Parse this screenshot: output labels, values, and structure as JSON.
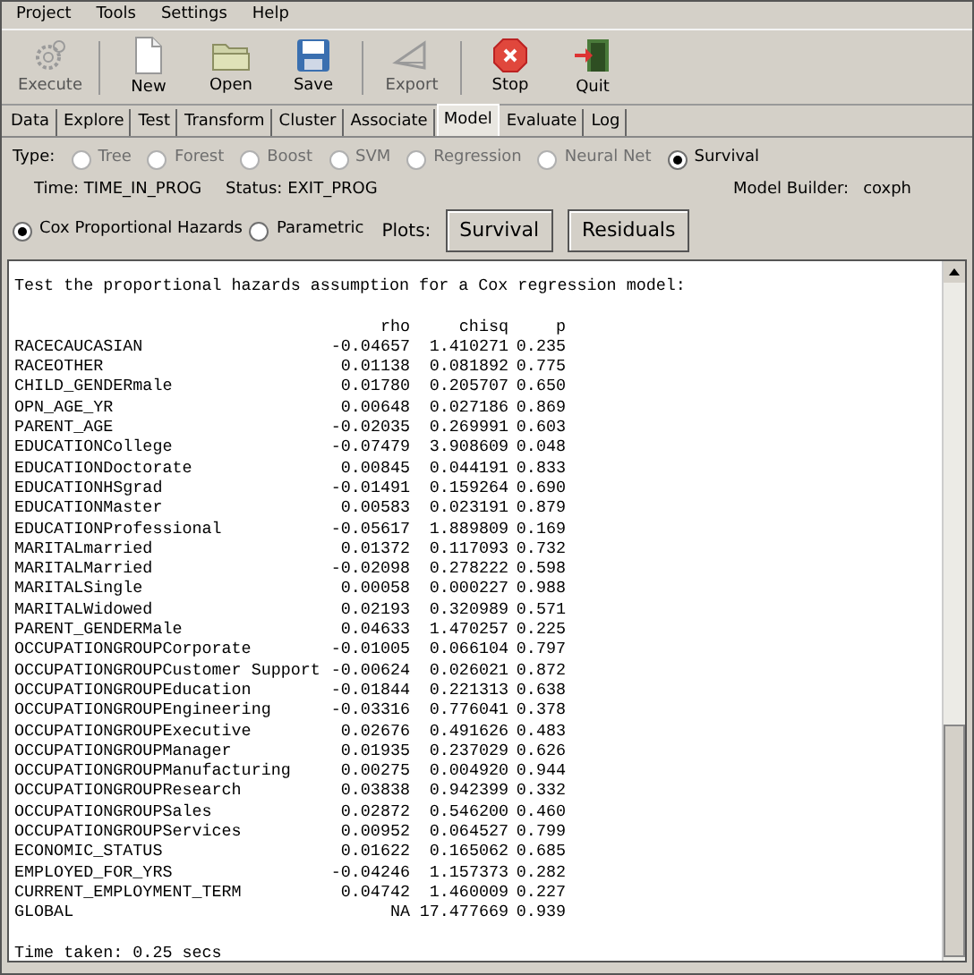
{
  "menu": [
    "Project",
    "Tools",
    "Settings",
    "Help"
  ],
  "toolbar": [
    {
      "label": "Execute",
      "kind": "gear",
      "disabled": true
    },
    {
      "label": "New",
      "kind": "new",
      "disabled": false
    },
    {
      "label": "Open",
      "kind": "open",
      "disabled": false
    },
    {
      "label": "Save",
      "kind": "save",
      "disabled": false
    },
    {
      "label": "Export",
      "kind": "export",
      "disabled": true
    },
    {
      "label": "Stop",
      "kind": "stop",
      "disabled": false
    },
    {
      "label": "Quit",
      "kind": "quit",
      "disabled": false
    }
  ],
  "tabs": [
    {
      "label": "Data",
      "selected": false
    },
    {
      "label": "Explore",
      "selected": false
    },
    {
      "label": "Test",
      "selected": false
    },
    {
      "label": "Transform",
      "selected": false
    },
    {
      "label": "Cluster",
      "selected": false
    },
    {
      "label": "Associate",
      "selected": false
    },
    {
      "label": "Model",
      "selected": true
    },
    {
      "label": "Evaluate",
      "selected": false
    },
    {
      "label": "Log",
      "selected": false
    }
  ],
  "type_label": "Type:",
  "types": [
    {
      "label": "Tree",
      "selected": false,
      "disabled": true
    },
    {
      "label": "Forest",
      "selected": false,
      "disabled": true
    },
    {
      "label": "Boost",
      "selected": false,
      "disabled": true
    },
    {
      "label": "SVM",
      "selected": false,
      "disabled": true
    },
    {
      "label": "Regression",
      "selected": false,
      "disabled": true
    },
    {
      "label": "Neural Net",
      "selected": false,
      "disabled": true
    },
    {
      "label": "Survival",
      "selected": true,
      "disabled": false
    }
  ],
  "time": "Time: TIME_IN_PROG",
  "status": "Status: EXIT_PROG",
  "builder_label": "Model Builder:",
  "builder": "coxph",
  "methods": [
    {
      "label": "Cox Proportional Hazards",
      "selected": true
    },
    {
      "label": "Parametric",
      "selected": false
    }
  ],
  "plots_label": "Plots:",
  "plot_buttons": [
    "Survival",
    "Residuals"
  ],
  "output": {
    "title": "Test the proportional hazards assumption for a Cox regression model:",
    "columns": [
      "",
      "rho",
      "chisq",
      "p"
    ],
    "rows": [
      [
        "RACECAUCASIAN",
        "-0.04657",
        "1.410271",
        "0.235"
      ],
      [
        "RACEOTHER",
        "0.01138",
        "0.081892",
        "0.775"
      ],
      [
        "CHILD_GENDERmale",
        "0.01780",
        "0.205707",
        "0.650"
      ],
      [
        "OPN_AGE_YR",
        "0.00648",
        "0.027186",
        "0.869"
      ],
      [
        "PARENT_AGE",
        "-0.02035",
        "0.269991",
        "0.603"
      ],
      [
        "EDUCATIONCollege",
        "-0.07479",
        "3.908609",
        "0.048"
      ],
      [
        "EDUCATIONDoctorate",
        "0.00845",
        "0.044191",
        "0.833"
      ],
      [
        "EDUCATIONHSgrad",
        "-0.01491",
        "0.159264",
        "0.690"
      ],
      [
        "EDUCATIONMaster",
        "0.00583",
        "0.023191",
        "0.879"
      ],
      [
        "EDUCATIONProfessional",
        "-0.05617",
        "1.889809",
        "0.169"
      ],
      [
        "MARITALmarried",
        "0.01372",
        "0.117093",
        "0.732"
      ],
      [
        "MARITALMarried",
        "-0.02098",
        "0.278222",
        "0.598"
      ],
      [
        "MARITALSingle",
        "0.00058",
        "0.000227",
        "0.988"
      ],
      [
        "MARITALWidowed",
        "0.02193",
        "0.320989",
        "0.571"
      ],
      [
        "PARENT_GENDERMale",
        "0.04633",
        "1.470257",
        "0.225"
      ],
      [
        "OCCUPATIONGROUPCorporate",
        "-0.01005",
        "0.066104",
        "0.797"
      ],
      [
        "OCCUPATIONGROUPCustomer Support",
        "-0.00624",
        "0.026021",
        "0.872"
      ],
      [
        "OCCUPATIONGROUPEducation",
        "-0.01844",
        "0.221313",
        "0.638"
      ],
      [
        "OCCUPATIONGROUPEngineering",
        "-0.03316",
        "0.776041",
        "0.378"
      ],
      [
        "OCCUPATIONGROUPExecutive",
        "0.02676",
        "0.491626",
        "0.483"
      ],
      [
        "OCCUPATIONGROUPManager",
        "0.01935",
        "0.237029",
        "0.626"
      ],
      [
        "OCCUPATIONGROUPManufacturing",
        "0.00275",
        "0.004920",
        "0.944"
      ],
      [
        "OCCUPATIONGROUPResearch",
        "0.03838",
        "0.942399",
        "0.332"
      ],
      [
        "OCCUPATIONGROUPSales",
        "0.02872",
        "0.546200",
        "0.460"
      ],
      [
        "OCCUPATIONGROUPServices",
        "0.00952",
        "0.064527",
        "0.799"
      ],
      [
        "ECONOMIC_STATUS",
        "0.01622",
        "0.165062",
        "0.685"
      ],
      [
        "EMPLOYED_FOR_YRS",
        "-0.04246",
        "1.157373",
        "0.282"
      ],
      [
        "CURRENT_EMPLOYMENT_TERM",
        "0.04742",
        "1.460009",
        "0.227"
      ],
      [
        "GLOBAL",
        "NA",
        "17.477669",
        "0.939"
      ]
    ],
    "footer": "Time taken: 0.25 secs"
  }
}
